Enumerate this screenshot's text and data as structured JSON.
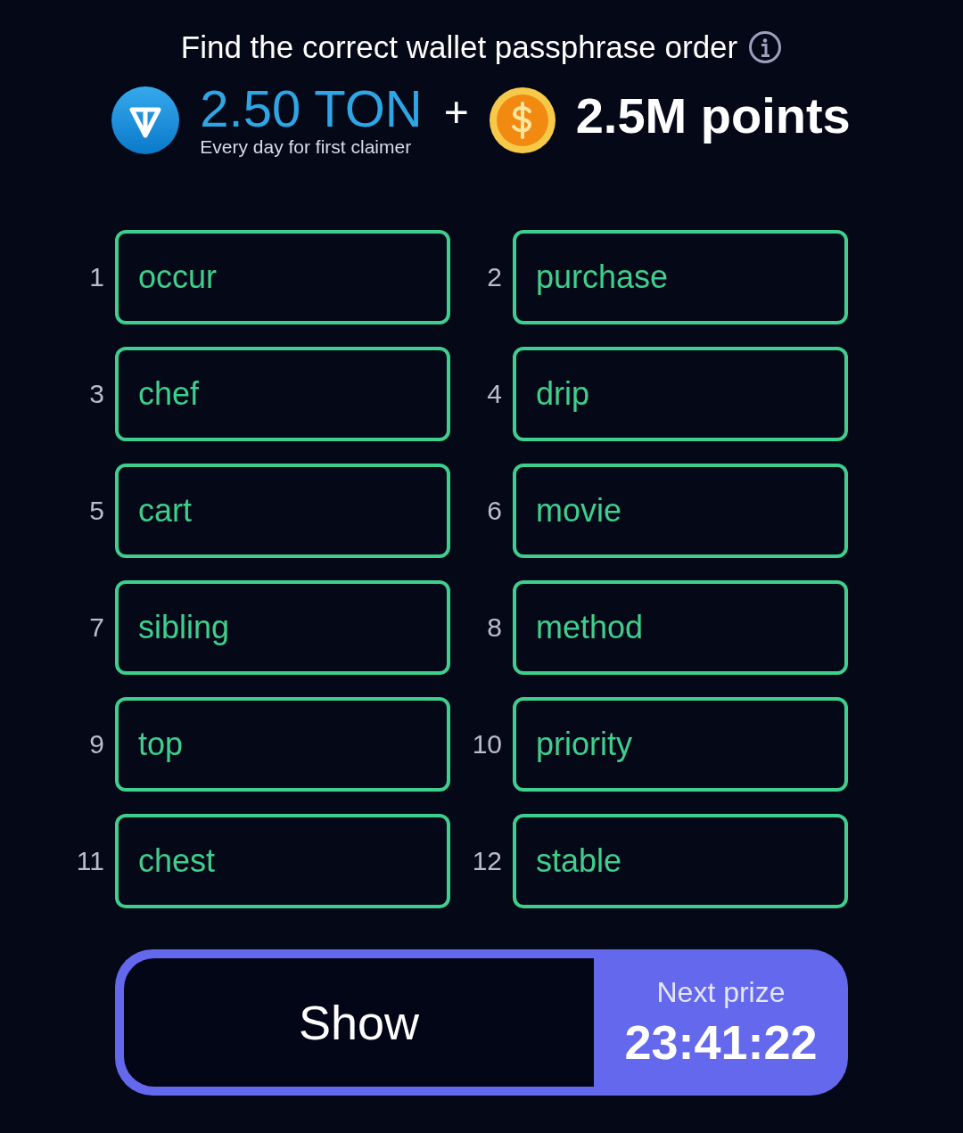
{
  "title": "Find the correct wallet passphrase order",
  "reward": {
    "ton_amount": "2.50 TON",
    "ton_note": "Every day for first claimer",
    "plus": "+",
    "points": "2.5M points"
  },
  "words": [
    {
      "number": "1",
      "word": "occur"
    },
    {
      "number": "2",
      "word": "purchase"
    },
    {
      "number": "3",
      "word": "chef"
    },
    {
      "number": "4",
      "word": "drip"
    },
    {
      "number": "5",
      "word": "cart"
    },
    {
      "number": "6",
      "word": "movie"
    },
    {
      "number": "7",
      "word": "sibling"
    },
    {
      "number": "8",
      "word": "method"
    },
    {
      "number": "9",
      "word": "top"
    },
    {
      "number": "10",
      "word": "priority"
    },
    {
      "number": "11",
      "word": "chest"
    },
    {
      "number": "12",
      "word": "stable"
    }
  ],
  "show_button": "Show",
  "next_prize": {
    "label": "Next prize",
    "time": "23:41:22"
  }
}
